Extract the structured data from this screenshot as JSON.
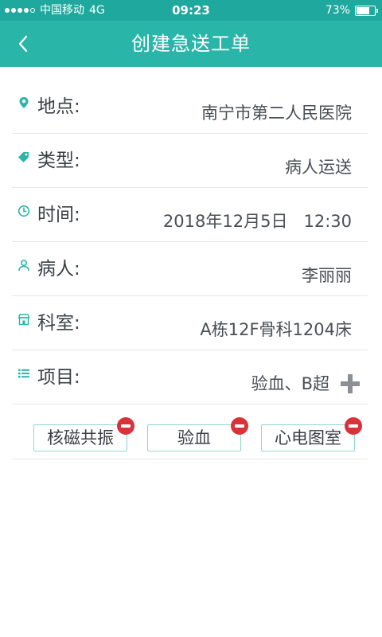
{
  "status_bar": {
    "carrier": "中国移动",
    "network": "4G",
    "time": "09:23",
    "battery_text": "73%",
    "battery_level": 0.73,
    "signal_filled": 4,
    "signal_total": 5
  },
  "header": {
    "title": "创建急送工单",
    "back_icon": "chevron-left-icon"
  },
  "form": {
    "location": {
      "label": "地点:",
      "value": "南宁市第二人民医院",
      "icon": "location-pin-icon"
    },
    "type": {
      "label": "类型:",
      "value": "病人运送",
      "icon": "tag-icon"
    },
    "time": {
      "label": "时间:",
      "value": "2018年12月5日   12:30",
      "icon": "clock-icon"
    },
    "patient": {
      "label": "病人:",
      "value": "李丽丽",
      "icon": "person-icon"
    },
    "department": {
      "label": "科室:",
      "value": "A栋12F骨科1204床",
      "icon": "building-icon"
    },
    "items": {
      "label": "项目:",
      "value": "验血、B超",
      "icon": "list-icon",
      "add_icon": "plus-icon"
    }
  },
  "selected_items": [
    {
      "label": "核磁共振"
    },
    {
      "label": "验血"
    },
    {
      "label": "心电图室"
    }
  ],
  "colors": {
    "status_bar": "#1fa89d",
    "header": "#2ab5a9",
    "accent": "#2ab5a9",
    "remove": "#d9323a",
    "add": "#8c9096"
  }
}
